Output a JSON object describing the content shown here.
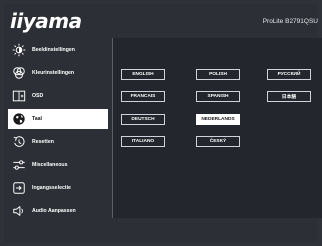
{
  "header": {
    "logo": "iiyama",
    "model": "ProLite B2791QSU"
  },
  "sidebar": {
    "items": [
      {
        "label": "Beeldinstellingen",
        "icon": "brightness-icon"
      },
      {
        "label": "Kleurinstellingen",
        "icon": "color-palette-icon"
      },
      {
        "label": "OSD",
        "icon": "osd-icon"
      },
      {
        "label": "Taal",
        "icon": "globe-icon",
        "active": true
      },
      {
        "label": "Resetten",
        "icon": "reset-icon"
      },
      {
        "label": "Miscellaneous",
        "icon": "settings-sliders-icon"
      },
      {
        "label": "Ingangsselectie",
        "icon": "input-select-icon"
      },
      {
        "label": "Audio Aanpassen",
        "icon": "speaker-icon"
      }
    ]
  },
  "languages": {
    "items": [
      "ENGLISH",
      "POLISH",
      "РУССКИЙ",
      "FRANCAIS",
      "SPANISH",
      "日本語",
      "DEUTSCH",
      "NEDERLANDS",
      "ITALIANO",
      "ČESKÝ"
    ],
    "selected": "NEDERLANDS"
  },
  "colors": {
    "background": "#2f3238",
    "content": "#23272d",
    "active": "#ffffff"
  }
}
